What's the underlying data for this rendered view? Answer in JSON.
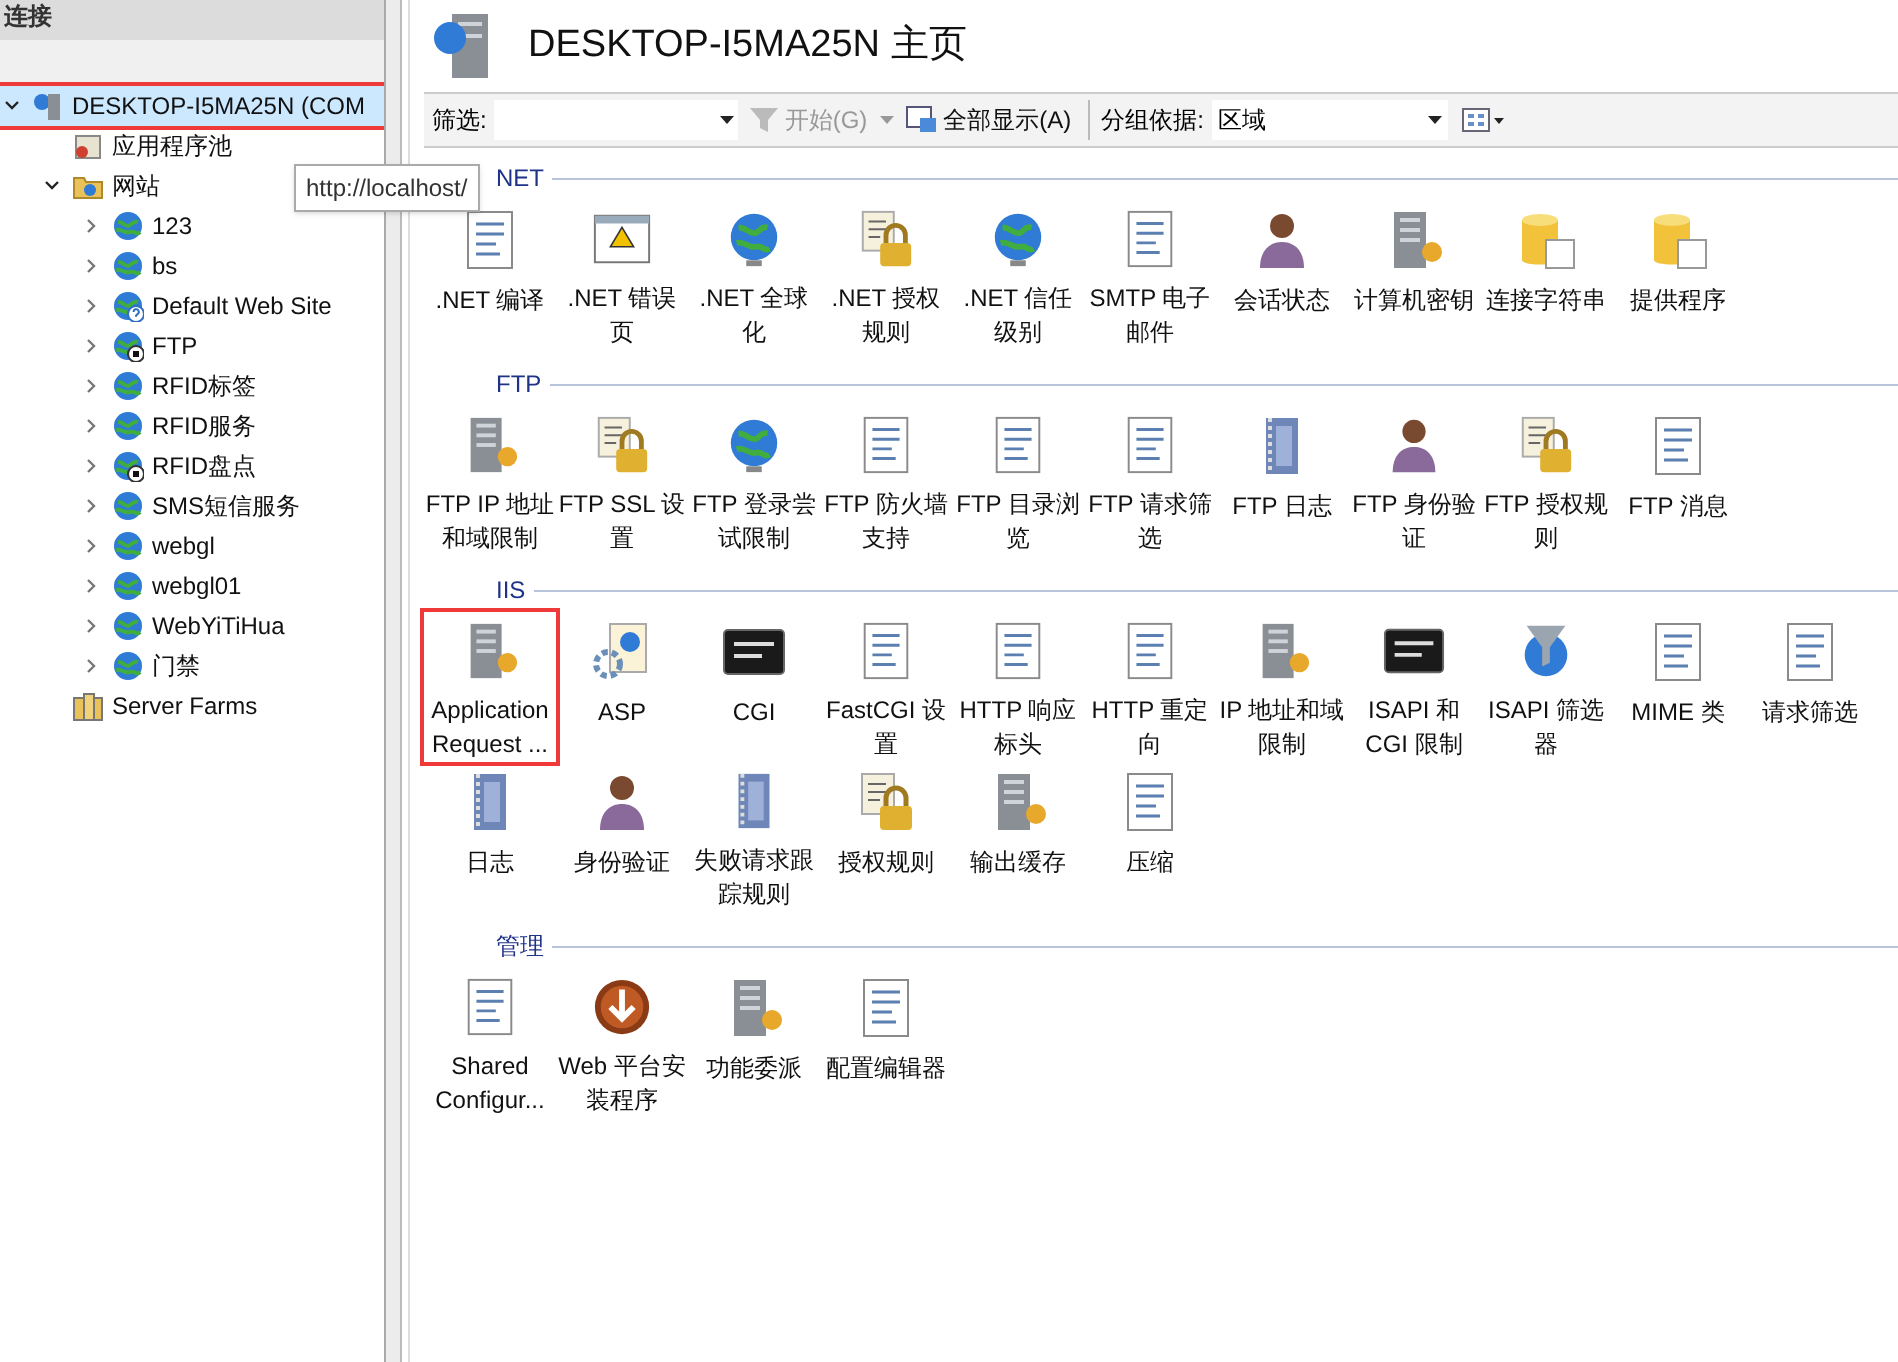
{
  "connections": {
    "title": "连接",
    "tree": [
      {
        "label": "DESKTOP-I5MA25N (COM",
        "kind": "server",
        "expanded": true,
        "selected": true,
        "highlighted": true,
        "children": [
          {
            "label": "应用程序池",
            "kind": "pools",
            "selected": false
          },
          {
            "label": "网站",
            "kind": "folder",
            "expanded": true,
            "selected": false,
            "children": [
              {
                "label": "123",
                "kind": "site",
                "expanded": false,
                "selected": false
              },
              {
                "label": "bs",
                "kind": "site",
                "expanded": false,
                "selected": false
              },
              {
                "label": "Default Web Site",
                "kind": "unknown",
                "expanded": false,
                "selected": false
              },
              {
                "label": "FTP",
                "kind": "stopped",
                "expanded": false,
                "selected": false
              },
              {
                "label": "RFID标签",
                "kind": "site",
                "expanded": false,
                "selected": false
              },
              {
                "label": "RFID服务",
                "kind": "site",
                "expanded": false,
                "selected": false
              },
              {
                "label": "RFID盘点",
                "kind": "stopped",
                "expanded": false,
                "selected": false
              },
              {
                "label": "SMS短信服务",
                "kind": "site",
                "expanded": false,
                "selected": false
              },
              {
                "label": "webgl",
                "kind": "site",
                "expanded": false,
                "selected": false
              },
              {
                "label": "webgl01",
                "kind": "site",
                "expanded": false,
                "selected": false
              },
              {
                "label": "WebYiTiHua",
                "kind": "site",
                "expanded": false,
                "selected": false
              },
              {
                "label": "门禁",
                "kind": "site",
                "expanded": false,
                "selected": false
              }
            ]
          },
          {
            "label": "Server Farms",
            "kind": "farm",
            "selected": false
          }
        ]
      }
    ]
  },
  "tooltip": "http://localhost/",
  "main": {
    "title": "DESKTOP-I5MA25N 主页",
    "toolbar": {
      "filter_label": "筛选:",
      "start_button": {
        "label": "开始(G)",
        "disabled": true
      },
      "show_all_button": "全部显示(A)",
      "group_label": "分组依据:",
      "group_value": "区域"
    },
    "groups": [
      {
        "title": "NET",
        "items": [
          {
            "label": ".NET 编译"
          },
          {
            "label": ".NET 错误页"
          },
          {
            "label": ".NET 全球化"
          },
          {
            "label": ".NET 授权规则"
          },
          {
            "label": ".NET 信任级别"
          },
          {
            "label": "SMTP 电子邮件"
          },
          {
            "label": "会话状态"
          },
          {
            "label": "计算机密钥"
          },
          {
            "label": "连接字符串"
          },
          {
            "label": "提供程序"
          }
        ]
      },
      {
        "title": "FTP",
        "items": [
          {
            "label": "FTP IP 地址和域限制"
          },
          {
            "label": "FTP SSL 设置"
          },
          {
            "label": "FTP 登录尝试限制"
          },
          {
            "label": "FTP 防火墙支持"
          },
          {
            "label": "FTP 目录浏览"
          },
          {
            "label": "FTP 请求筛选"
          },
          {
            "label": "FTP 日志"
          },
          {
            "label": "FTP 身份验证"
          },
          {
            "label": "FTP 授权规则"
          },
          {
            "label": "FTP 消息"
          }
        ]
      },
      {
        "title": "IIS",
        "items": [
          {
            "label": "Application Request ...",
            "highlighted": true
          },
          {
            "label": "ASP"
          },
          {
            "label": "CGI"
          },
          {
            "label": "FastCGI 设置"
          },
          {
            "label": "HTTP 响应标头"
          },
          {
            "label": "HTTP 重定向"
          },
          {
            "label": "IP 地址和域限制"
          },
          {
            "label": "ISAPI 和 CGI 限制"
          },
          {
            "label": "ISAPI 筛选器"
          },
          {
            "label": "MIME 类"
          },
          {
            "label": "请求筛选"
          },
          {
            "label": "日志"
          },
          {
            "label": "身份验证"
          },
          {
            "label": "失败请求跟踪规则"
          },
          {
            "label": "授权规则"
          },
          {
            "label": "输出缓存"
          },
          {
            "label": "压缩"
          }
        ]
      },
      {
        "title": "管理",
        "items": [
          {
            "label": "Shared Configur..."
          },
          {
            "label": "Web 平台安装程序"
          },
          {
            "label": "功能委派"
          },
          {
            "label": "配置编辑器"
          }
        ]
      }
    ]
  }
}
